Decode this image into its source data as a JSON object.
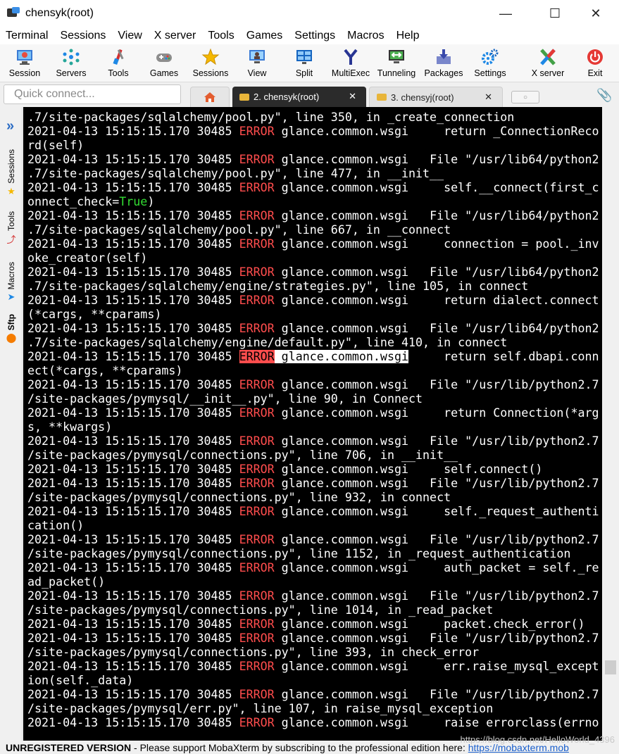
{
  "window": {
    "title": "chensyk(root)"
  },
  "menu": [
    "Terminal",
    "Sessions",
    "View",
    "X server",
    "Tools",
    "Games",
    "Settings",
    "Macros",
    "Help"
  ],
  "toolbar": {
    "session": "Session",
    "servers": "Servers",
    "tools": "Tools",
    "games": "Games",
    "sessions": "Sessions",
    "view": "View",
    "split": "Split",
    "multiexec": "MultiExec",
    "tunneling": "Tunneling",
    "packages": "Packages",
    "settings": "Settings",
    "xserver": "X server",
    "exit": "Exit"
  },
  "tabs": {
    "quick_connect_placeholder": "Quick connect...",
    "tab1": "2. chensyk(root)",
    "tab2": "3. chensyj(root)"
  },
  "sidepanel": {
    "sessions": "Sessions",
    "tools": "Tools",
    "macros": "Macros",
    "sftp": "Sftp"
  },
  "log": {
    "prefix": "2021-04-13 15:15:15.170 30485 ",
    "level": "ERROR",
    "module": " glance.common.wsgi",
    "lines": [
      {
        "type": "cont",
        "text": ".7/site-packages/sqlalchemy/pool.py\", line 350, in _create_connection"
      },
      {
        "type": "log",
        "msg": "     return _ConnectionReco"
      },
      {
        "type": "cont",
        "text": "rd(self)"
      },
      {
        "type": "log",
        "msg": "   File \"/usr/lib64/python2"
      },
      {
        "type": "cont",
        "text": ".7/site-packages/sqlalchemy/pool.py\", line 477, in __init__"
      },
      {
        "type": "log",
        "msg": "     self.__connect(first_c"
      },
      {
        "type": "cont_true",
        "text": "onnect_check=",
        "tval": "True",
        "tail": ")"
      },
      {
        "type": "log",
        "msg": "   File \"/usr/lib64/python2"
      },
      {
        "type": "cont",
        "text": ".7/site-packages/sqlalchemy/pool.py\", line 667, in __connect"
      },
      {
        "type": "log",
        "msg": "     connection = pool._inv"
      },
      {
        "type": "cont",
        "text": "oke_creator(self)"
      },
      {
        "type": "log",
        "msg": "   File \"/usr/lib64/python2"
      },
      {
        "type": "cont",
        "text": ".7/site-packages/sqlalchemy/engine/strategies.py\", line 105, in connect"
      },
      {
        "type": "log",
        "msg": "     return dialect.connect"
      },
      {
        "type": "cont",
        "text": "(*cargs, **cparams)"
      },
      {
        "type": "log",
        "msg": "   File \"/usr/lib64/python2"
      },
      {
        "type": "cont",
        "text": ".7/site-packages/sqlalchemy/engine/default.py\", line 410, in connect"
      },
      {
        "type": "log_hl",
        "msg": "     return self.dbapi.conn"
      },
      {
        "type": "cont",
        "text": "ect(*cargs, **cparams)"
      },
      {
        "type": "log",
        "msg": "   File \"/usr/lib/python2.7"
      },
      {
        "type": "cont",
        "text": "/site-packages/pymysql/__init__.py\", line 90, in Connect"
      },
      {
        "type": "log",
        "msg": "     return Connection(*arg"
      },
      {
        "type": "cont",
        "text": "s, **kwargs)"
      },
      {
        "type": "log",
        "msg": "   File \"/usr/lib/python2.7"
      },
      {
        "type": "cont",
        "text": "/site-packages/pymysql/connections.py\", line 706, in __init__"
      },
      {
        "type": "log",
        "msg": "     self.connect()"
      },
      {
        "type": "log",
        "msg": "   File \"/usr/lib/python2.7"
      },
      {
        "type": "cont",
        "text": "/site-packages/pymysql/connections.py\", line 932, in connect"
      },
      {
        "type": "log",
        "msg": "     self._request_authenti"
      },
      {
        "type": "cont",
        "text": "cation()"
      },
      {
        "type": "log",
        "msg": "   File \"/usr/lib/python2.7"
      },
      {
        "type": "cont",
        "text": "/site-packages/pymysql/connections.py\", line 1152, in _request_authentication"
      },
      {
        "type": "log",
        "msg": "     auth_packet = self._re"
      },
      {
        "type": "cont",
        "text": "ad_packet()"
      },
      {
        "type": "log",
        "msg": "   File \"/usr/lib/python2.7"
      },
      {
        "type": "cont",
        "text": "/site-packages/pymysql/connections.py\", line 1014, in _read_packet"
      },
      {
        "type": "log",
        "msg": "     packet.check_error()"
      },
      {
        "type": "log",
        "msg": "   File \"/usr/lib/python2.7"
      },
      {
        "type": "cont",
        "text": "/site-packages/pymysql/connections.py\", line 393, in check_error"
      },
      {
        "type": "log",
        "msg": "     err.raise_mysql_except"
      },
      {
        "type": "cont",
        "text": "ion(self._data)"
      },
      {
        "type": "log",
        "msg": "   File \"/usr/lib/python2.7"
      },
      {
        "type": "cont",
        "text": "/site-packages/pymysql/err.py\", line 107, in raise_mysql_exception"
      },
      {
        "type": "log",
        "msg": "     raise errorclass(errno"
      }
    ]
  },
  "statusbar": {
    "reg": "UNREGISTERED VERSION",
    "text": "  -  Please support MobaXterm by subscribing to the professional edition here:  ",
    "link": "https://mobaxterm.mob"
  },
  "watermark": "https://blog.csdn.net/HelloWorld_4396",
  "colors": {
    "error": "#ff4d4d",
    "true": "#33dd33",
    "terminal_bg": "#000000",
    "accent": "#2b6cc4"
  }
}
